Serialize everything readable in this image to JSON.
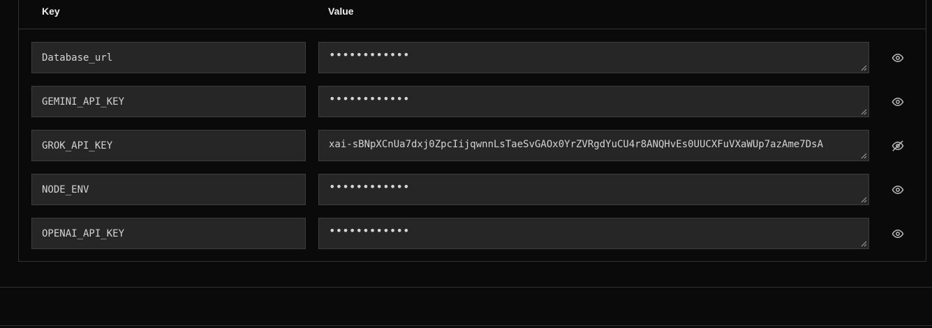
{
  "table": {
    "header": {
      "key_label": "Key",
      "value_label": "Value"
    },
    "rows": [
      {
        "key": "Database_url",
        "value": "••••••••••••",
        "revealed": false,
        "eye_icon": "eye-icon"
      },
      {
        "key": "GEMINI_API_KEY",
        "value": "••••••••••••",
        "revealed": false,
        "eye_icon": "eye-icon"
      },
      {
        "key": "GROK_API_KEY",
        "value": "xai-sBNpXCnUa7dxj0ZpcIijqwnnLsTaeSvGAOx0YrZVRgdYuCU4r8ANQHvEs0UUCXFuVXaWUp7azAme7DsA",
        "revealed": true,
        "eye_icon": "eye-off-icon"
      },
      {
        "key": "NODE_ENV",
        "value": "••••••••••••",
        "revealed": false,
        "eye_icon": "eye-icon"
      },
      {
        "key": "OPENAI_API_KEY",
        "value": "••••••••••••",
        "revealed": false,
        "eye_icon": "eye-icon"
      }
    ]
  },
  "colors": {
    "background": "#0a0a0a",
    "field_bg": "#262626",
    "border": "#333333",
    "text": "#d4d4d4",
    "icon": "#bdbdbd"
  }
}
